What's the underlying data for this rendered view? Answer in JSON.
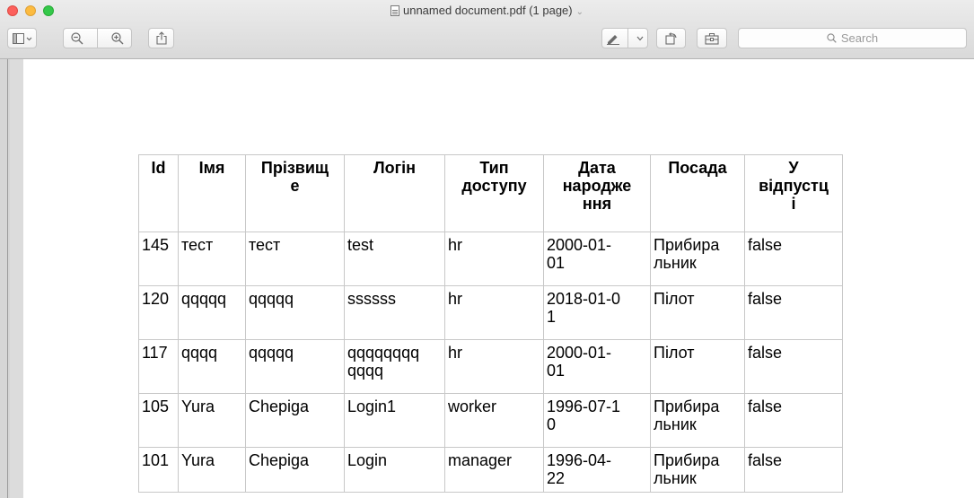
{
  "window": {
    "title": "unnamed document.pdf (1 page)"
  },
  "toolbar": {
    "sidebar_icon": "sidebar-icon",
    "zoom_out_icon": "zoom-out-icon",
    "zoom_in_icon": "zoom-in-icon",
    "share_icon": "share-icon",
    "markup_icon": "pen-icon",
    "rotate_icon": "rotate-icon",
    "toolbox_icon": "toolbox-icon"
  },
  "search": {
    "placeholder": "Search"
  },
  "table": {
    "headers": [
      "Id",
      "Імя",
      "Прізвище",
      "Логін",
      "Тип доступу",
      "Дата народження",
      "Посада",
      "У відпустці"
    ],
    "header_lines": [
      [
        "Id"
      ],
      [
        "Імя"
      ],
      [
        "Прізвищ",
        "е"
      ],
      [
        "Логін"
      ],
      [
        "Тип",
        "доступу"
      ],
      [
        "Дата",
        "народже",
        "ння"
      ],
      [
        "Посада"
      ],
      [
        "У",
        "відпустц",
        "і"
      ]
    ],
    "rows": [
      {
        "id": "145",
        "first": "тест",
        "last": "тест",
        "login": "test",
        "access": "hr",
        "birth": "2000-01-01",
        "position": "Прибиральник",
        "vacation": "false",
        "lines": {
          "birth": [
            "2000-01-",
            "01"
          ],
          "position": [
            "Прибира",
            "льник"
          ],
          "login": [
            "test"
          ]
        }
      },
      {
        "id": "120",
        "first": "qqqqq",
        "last": "qqqqq",
        "login": "ssssss",
        "access": "hr",
        "birth": "2018-01-01",
        "position": "Пілот",
        "vacation": "false",
        "lines": {
          "birth": [
            "2018-01-0",
            "1"
          ],
          "position": [
            "Пілот"
          ],
          "login": [
            "ssssss"
          ]
        }
      },
      {
        "id": "117",
        "first": "qqqq",
        "last": "qqqqq",
        "login": "qqqqqqqqqqqq",
        "access": "hr",
        "birth": "2000-01-01",
        "position": "Пілот",
        "vacation": "false",
        "lines": {
          "birth": [
            "2000-01-",
            "01"
          ],
          "position": [
            "Пілот"
          ],
          "login": [
            "qqqqqqqq",
            "qqqq"
          ]
        }
      },
      {
        "id": "105",
        "first": "Yura",
        "last": "Chepiga",
        "login": "Login1",
        "access": "worker",
        "birth": "1996-07-10",
        "position": "Прибиральник",
        "vacation": "false",
        "lines": {
          "birth": [
            "1996-07-1",
            "0"
          ],
          "position": [
            "Прибира",
            "льник"
          ],
          "login": [
            "Login1"
          ]
        }
      },
      {
        "id": "101",
        "first": "Yura",
        "last": "Chepiga",
        "login": "Login",
        "access": "manager",
        "birth": "1996-04-22",
        "position": "Прибиральник",
        "vacation": "false",
        "lines": {
          "birth": [
            "1996-04-",
            "22"
          ],
          "position": [
            "Прибира",
            "льник"
          ],
          "login": [
            "Login"
          ]
        }
      }
    ]
  }
}
